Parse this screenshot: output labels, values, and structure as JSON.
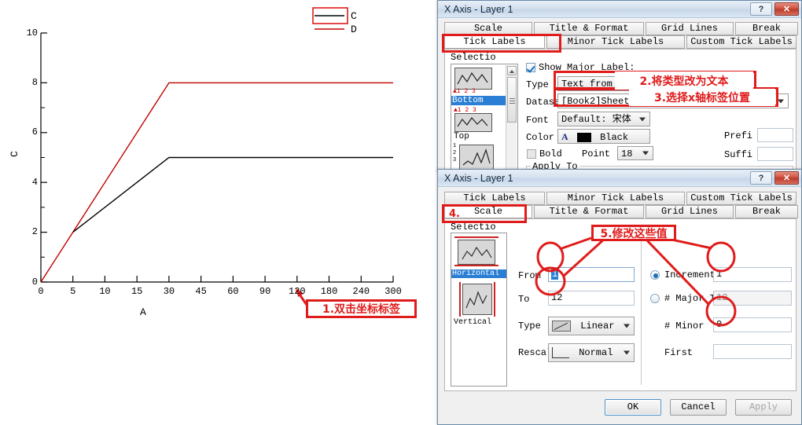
{
  "chart_data": {
    "type": "line",
    "title": "",
    "xlabel": "A",
    "ylabel": "C",
    "x_tick_labels": [
      "0",
      "5",
      "10",
      "15",
      "30",
      "45",
      "60",
      "90",
      "120",
      "180",
      "240",
      "300"
    ],
    "y_tick_labels": [
      "0",
      "2",
      "4",
      "6",
      "8",
      "10"
    ],
    "ylim": [
      0,
      10
    ],
    "grid": false,
    "legend_position": "top-right",
    "series": [
      {
        "name": "C",
        "color": "#000000",
        "x": [
          5,
          10,
          15,
          30,
          45,
          60,
          90,
          120,
          180,
          240,
          300
        ],
        "y": [
          2,
          3,
          3.9,
          5,
          5,
          5,
          5,
          5,
          5,
          5,
          5
        ]
      },
      {
        "name": "D",
        "color": "#c00000",
        "x": [
          0,
          5,
          10,
          15,
          30,
          45,
          60,
          90,
          120,
          180,
          240,
          300
        ],
        "y": [
          0,
          2,
          4,
          6,
          8,
          8,
          8,
          8,
          8,
          8,
          8
        ]
      }
    ],
    "legend": [
      {
        "label": "C",
        "color": "#000000",
        "highlighted": true
      },
      {
        "label": "D",
        "color": "#c00000",
        "highlighted": false
      }
    ]
  },
  "annotations": {
    "step1": "1.双击坐标标签",
    "step2": "2.将类型改为文本",
    "step3": "3.选择x轴标签位置",
    "step4": "4.",
    "step5": "5.修改这些值",
    "accent_color": "#e01b1b"
  },
  "dialog_ticklabels": {
    "title": "X Axis - Layer 1",
    "help_label": "?",
    "close_label": "✕",
    "tabs_row1": [
      "Scale",
      "Title & Format",
      "Grid Lines",
      "Break"
    ],
    "tabs_row2": [
      "Tick Labels",
      "Minor Tick Labels",
      "Custom Tick Labels"
    ],
    "active_tab": "Tick Labels",
    "selection_label": "Selectio",
    "selection_items": [
      "Bottom",
      "Top"
    ],
    "selected_item": "Bottom",
    "show_major_label": "Show Major Label:",
    "show_major_checked": true,
    "fields": {
      "type_label": "Type",
      "type_value": "Text from datas",
      "dataset_label": "Dataset",
      "dataset_value": "[Book2]Sheet1!A",
      "font_label": "Font",
      "font_value": "Default: 宋体",
      "color_label": "Color",
      "color_value": "Black",
      "color_swatch": "#000000",
      "color_icon": "A",
      "bold_label": "Bold",
      "bold_checked": false,
      "point_label": "Point",
      "point_value": "18",
      "prefix_label": "Prefi",
      "prefix_value": "",
      "suffix_label": "Suffi",
      "suffix_value": "",
      "apply_to_label": "Apply To"
    }
  },
  "dialog_scale": {
    "title": "X Axis - Layer 1",
    "help_label": "?",
    "close_label": "✕",
    "tabs_row1": [
      "Tick Labels",
      "Minor Tick Labels",
      "Custom Tick Labels"
    ],
    "tabs_row2": [
      "Scale",
      "Title & Format",
      "Grid Lines",
      "Break"
    ],
    "active_tab": "Scale",
    "selection_label": "Selectio",
    "selection_items": [
      "Horizontal",
      "Vertical"
    ],
    "selected_item": "Horizontal",
    "fields": {
      "from_label": "From",
      "from_value": "1",
      "to_label": "To",
      "to_value": "12",
      "type_label": "Type",
      "type_value": "Linear",
      "rescale_label": "Rescale",
      "rescale_value": "Normal",
      "increment_label": "Increment",
      "increment_value": "1",
      "increment_selected": true,
      "major_ticks_label": "# Major Ticl",
      "major_ticks_value": "12",
      "major_ticks_selected": false,
      "minor_label": "# Minor",
      "minor_value": "0",
      "first_label": "First",
      "first_value": ""
    },
    "buttons": {
      "ok": "OK",
      "cancel": "Cancel",
      "apply": "Apply"
    }
  }
}
